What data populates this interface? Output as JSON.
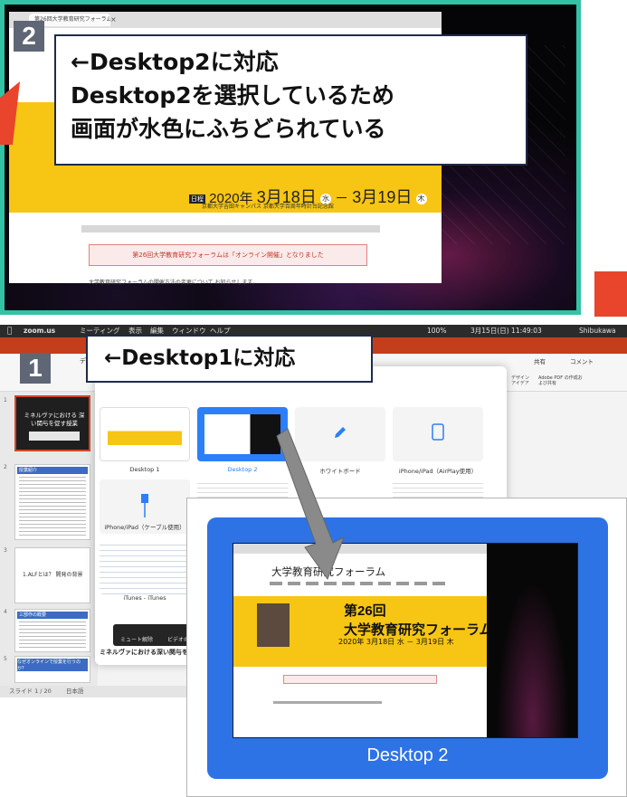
{
  "colors": {
    "desktop2_border": "#33c2a6",
    "accent_red": "#e8452c",
    "selection_blue": "#2d73e6",
    "banner_yellow": "#f7c514"
  },
  "badges": {
    "desktop2": "2",
    "desktop1": "1"
  },
  "callouts": {
    "desktop2": {
      "line1": "←Desktop2に対応",
      "line2": "Desktop2を選択しているため",
      "line3": "画面が水色にふちどられている"
    },
    "desktop1": {
      "text": "←Desktop1に対応"
    }
  },
  "desktop2_screen": {
    "browser_tab": "第26回大学教育研究フォーラム",
    "tab_close": "×",
    "date": {
      "year": "2020年",
      "start_month": "3月",
      "start_day": "18日",
      "start_dow": "水",
      "dash": "－",
      "end_month": "3月",
      "end_day": "19日",
      "end_dow": "木",
      "label": "日程"
    },
    "venue": "京都大学吉田キャンパス 京都大学百周年時計台記念館",
    "notice": "第26回大学教育研究フォーラムは「オンライン開催」となりました",
    "body": "大学教育研究フォーラムの開催方法の変更について お知らせします。"
  },
  "mac_menubar": {
    "app": "zoom.us",
    "menus": [
      "ミーティング",
      "表示",
      "編集",
      "ウィンドウ",
      "ヘルプ"
    ],
    "battery": "100%",
    "datetime": "3月15日(日) 11:49:03",
    "user": "Shibukawa"
  },
  "powerpoint": {
    "ribbon_tab": "デザイン",
    "ribbon_right": [
      "共有",
      "コメント"
    ],
    "ribbon_tools": [
      "デザイン アイデア",
      "Adobe PDF の作成および共有"
    ],
    "slides": [
      {
        "num": "1",
        "text": "ミネルヴァにおける 深い関与を促す授業"
      },
      {
        "num": "2",
        "text": "授業紹介"
      },
      {
        "num": "3",
        "text": "1.ALFとは？ 開発の背景"
      },
      {
        "num": "4",
        "text": "三部作の概要"
      },
      {
        "num": "5",
        "text": "なぜオンラインで授業を行うのか？"
      }
    ],
    "status": {
      "slide": "スライド 1 / 20",
      "lang": "日本語"
    }
  },
  "share_dialog": {
    "options": [
      {
        "label": "Desktop 1"
      },
      {
        "label": "Desktop 2",
        "selected": true
      },
      {
        "label": "ホワイトボード"
      },
      {
        "label": "iPhone/iPad（AirPlay使用）"
      },
      {
        "label": "iPhone/iPad（ケーブル使用）"
      },
      {
        "label": "iTunes - iTunes"
      }
    ],
    "toolbar": {
      "mute": "ミュート解除",
      "video": "ビデオの開始"
    },
    "slide_title": "ミネルヴァにおける深い関与を促す授"
  },
  "zoomed_tile": {
    "page_title": "大学教育研究フォーラム",
    "edition": "第26回",
    "forum_name": "大学教育研究フォーラム",
    "date_text": "2020年 3月18日 水 － 3月19日 木",
    "label": "Desktop 2"
  }
}
